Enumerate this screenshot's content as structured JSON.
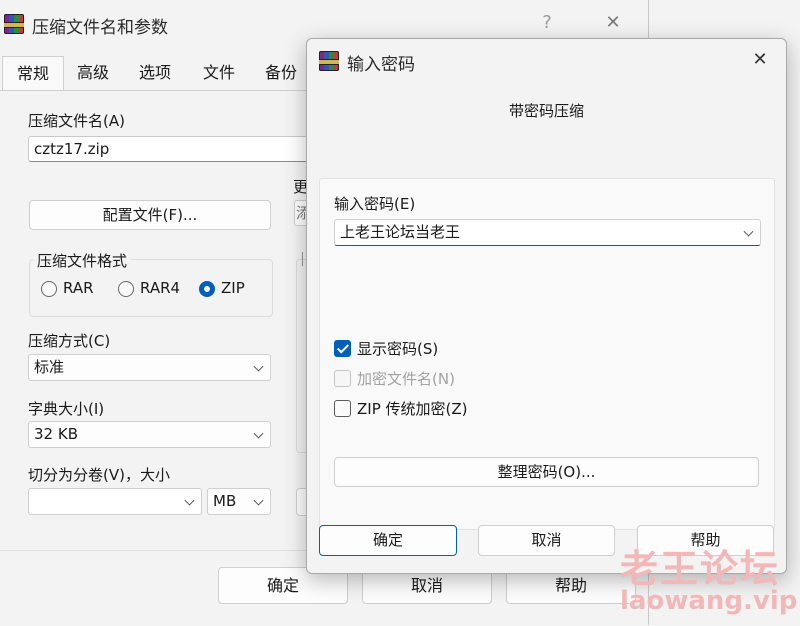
{
  "main_window": {
    "title": "压缩文件名和参数",
    "help_glyph": "?",
    "close_glyph": "✕",
    "tabs": [
      "常规",
      "高级",
      "选项",
      "文件",
      "备份"
    ],
    "archive_name_label": "压缩文件名(A)",
    "archive_name_value": "cztz17.zip",
    "update_label_partial": "更",
    "update_value_partial": "添",
    "profiles_button": "配置文件(F)...",
    "format_group_label": "压缩文件格式",
    "formats": [
      "RAR",
      "RAR4",
      "ZIP"
    ],
    "selected_format": "ZIP",
    "method_label": "压缩方式(C)",
    "method_value": "标准",
    "dict_label": "字典大小(I)",
    "dict_value": "32 KB",
    "split_label": "切分为分卷(V)，大小",
    "split_value": "",
    "split_unit": "MB",
    "ok": "确定",
    "cancel": "取消",
    "help": "帮助"
  },
  "password_dialog": {
    "title": "输入密码",
    "close_glyph": "✕",
    "subtitle": "带密码压缩",
    "enter_label": "输入密码(E)",
    "password_value": "上老王论坛当老王",
    "show_password_label": "显示密码(S)",
    "show_password_checked": true,
    "encrypt_names_label": "加密文件名(N)",
    "encrypt_names_enabled": false,
    "zip_legacy_label": "ZIP 传统加密(Z)",
    "zip_legacy_checked": false,
    "organize_button": "整理密码(O)...",
    "ok": "确定",
    "cancel": "取消",
    "help": "帮助"
  },
  "watermark": {
    "line1": "老王论坛",
    "line2": "laowang.vip"
  },
  "colors": {
    "accent": "#005fb8",
    "watermark": "#f2b8b8"
  }
}
